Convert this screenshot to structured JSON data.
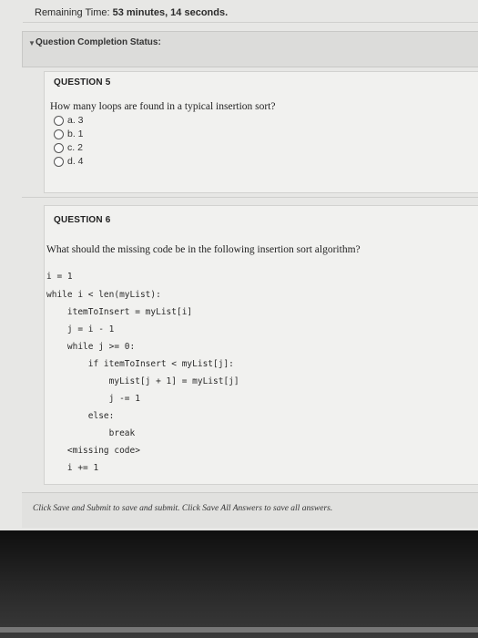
{
  "timer": {
    "label": "Remaining Time:",
    "value": "53 minutes, 14 seconds."
  },
  "completion_status": {
    "label": "Question Completion Status:"
  },
  "questions": [
    {
      "heading": "QUESTION 5",
      "text": "How many loops are found in a typical insertion sort?",
      "options": [
        "a. 3",
        "b. 1",
        "c. 2",
        "d. 4"
      ]
    },
    {
      "heading": "QUESTION 6",
      "text": "What should the missing code be in the following insertion sort algorithm?",
      "code": [
        "i = 1",
        "while i < len(myList):",
        "    itemToInsert = myList[i]",
        "    j = i - 1",
        "    while j >= 0:",
        "        if itemToInsert < myList[j]:",
        "            myList[j + 1] = myList[j]",
        "            j -= 1",
        "        else:",
        "            break",
        "    <missing code>",
        "    i += 1"
      ]
    }
  ],
  "footer": {
    "text": "Click Save and Submit to save and submit. Click Save All Answers to save all answers."
  }
}
